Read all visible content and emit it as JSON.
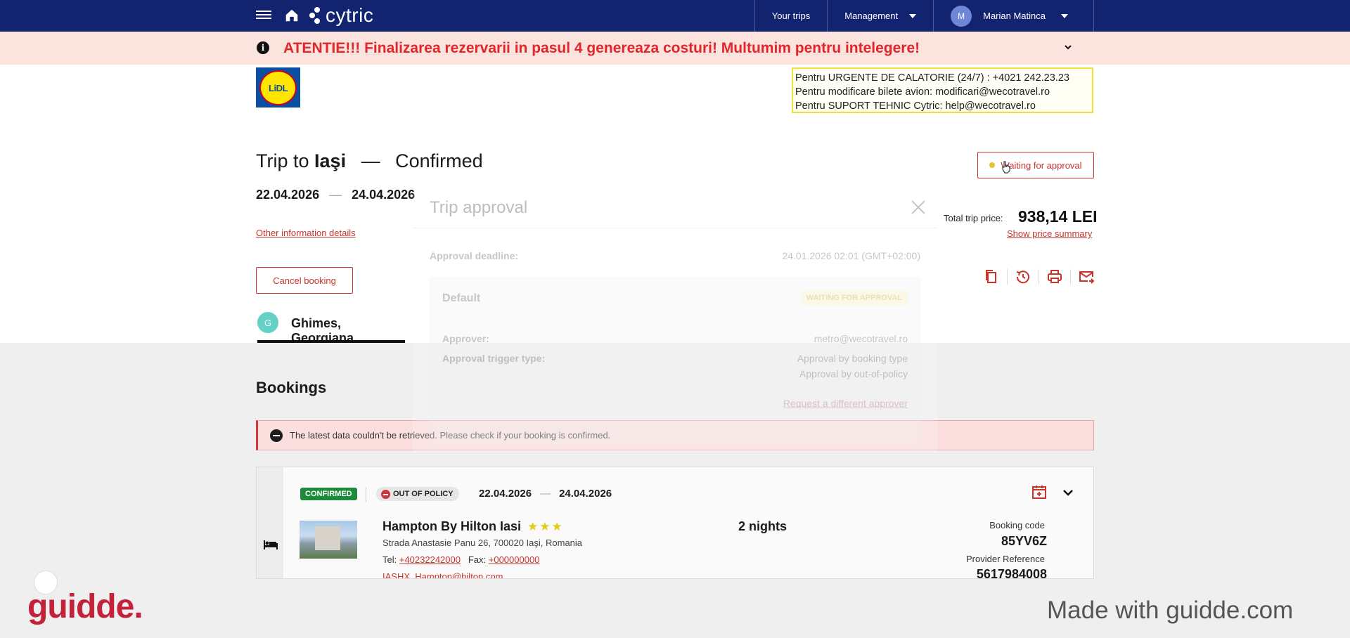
{
  "nav": {
    "logo_text": "cytric",
    "your_trips": "Your trips",
    "management": "Management",
    "user_initial": "M",
    "user_name": "Marian Matinca"
  },
  "banner": {
    "icon": "i",
    "text": "ATENTIE!!! Finalizarea rezervarii in pasul 4 genereaza costuri! Multumim pentru intelegere!"
  },
  "company": {
    "logo_text": "LiDL",
    "contacts": [
      "Pentru URGENTE DE CALATORIE (24/7) : +4021 242.23.23",
      "Pentru modificare bilete avion:  modificari@wecotravel.ro",
      "Pentru SUPORT TEHNIC Cytric:  help@wecotravel.ro"
    ]
  },
  "trip": {
    "title_prefix": "Trip to",
    "destination": "Iaşi",
    "dash": "—",
    "state": "Confirmed",
    "start_date": "22.04.2026",
    "end_date": "24.04.2026",
    "date_sep": "—",
    "other_info": "Other information details",
    "cancel": "Cancel booking",
    "status": "Waiting for approval",
    "price_label": "Total trip price:",
    "price_value": "938,14 LEI",
    "price_summary": "Show price summary"
  },
  "traveler": {
    "initial": "G",
    "name": "Ghimes, Georgiana"
  },
  "modal": {
    "title": "Trip approval",
    "deadline_label": "Approval deadline:",
    "deadline_value": "24.01.2026 02:01 (GMT+02:00)",
    "default_label": "Default",
    "status_badge": "WAITING FOR APPROVAL",
    "approver_label": "Approver:",
    "approver_value": "metro@wecotravel.ro",
    "trigger_label": "Approval trigger type:",
    "trigger_1": "Approval by booking type",
    "trigger_2": "Approval by out-of-policy",
    "request_link": "Request a different approver"
  },
  "bookings": {
    "title": "Bookings",
    "error": "The latest data couldn't be retrieved. Please check if your booking is confirmed.",
    "card": {
      "status": "CONFIRMED",
      "policy": "OUT OF POLICY",
      "start_date": "22.04.2026",
      "end_date": "24.04.2026",
      "date_sep": "—",
      "hotel_name": "Hampton By Hilton Iasi",
      "stars": "★★★",
      "address": "Strada Anastasie Panu 26, 700020 Iaşi, Romania",
      "tel_label": "Tel:",
      "tel": "+40232242000",
      "fax_label": "Fax:",
      "fax": "+000000000",
      "email": "IASHX_Hampton@hilton.com",
      "nights": "2 nights",
      "booking_code_label": "Booking code",
      "booking_code": "85YV6Z",
      "provider_label": "Provider Reference",
      "provider_code": "5617984008"
    }
  },
  "footer": {
    "brand": "guidde.",
    "made_with": "Made with guidde.com"
  }
}
